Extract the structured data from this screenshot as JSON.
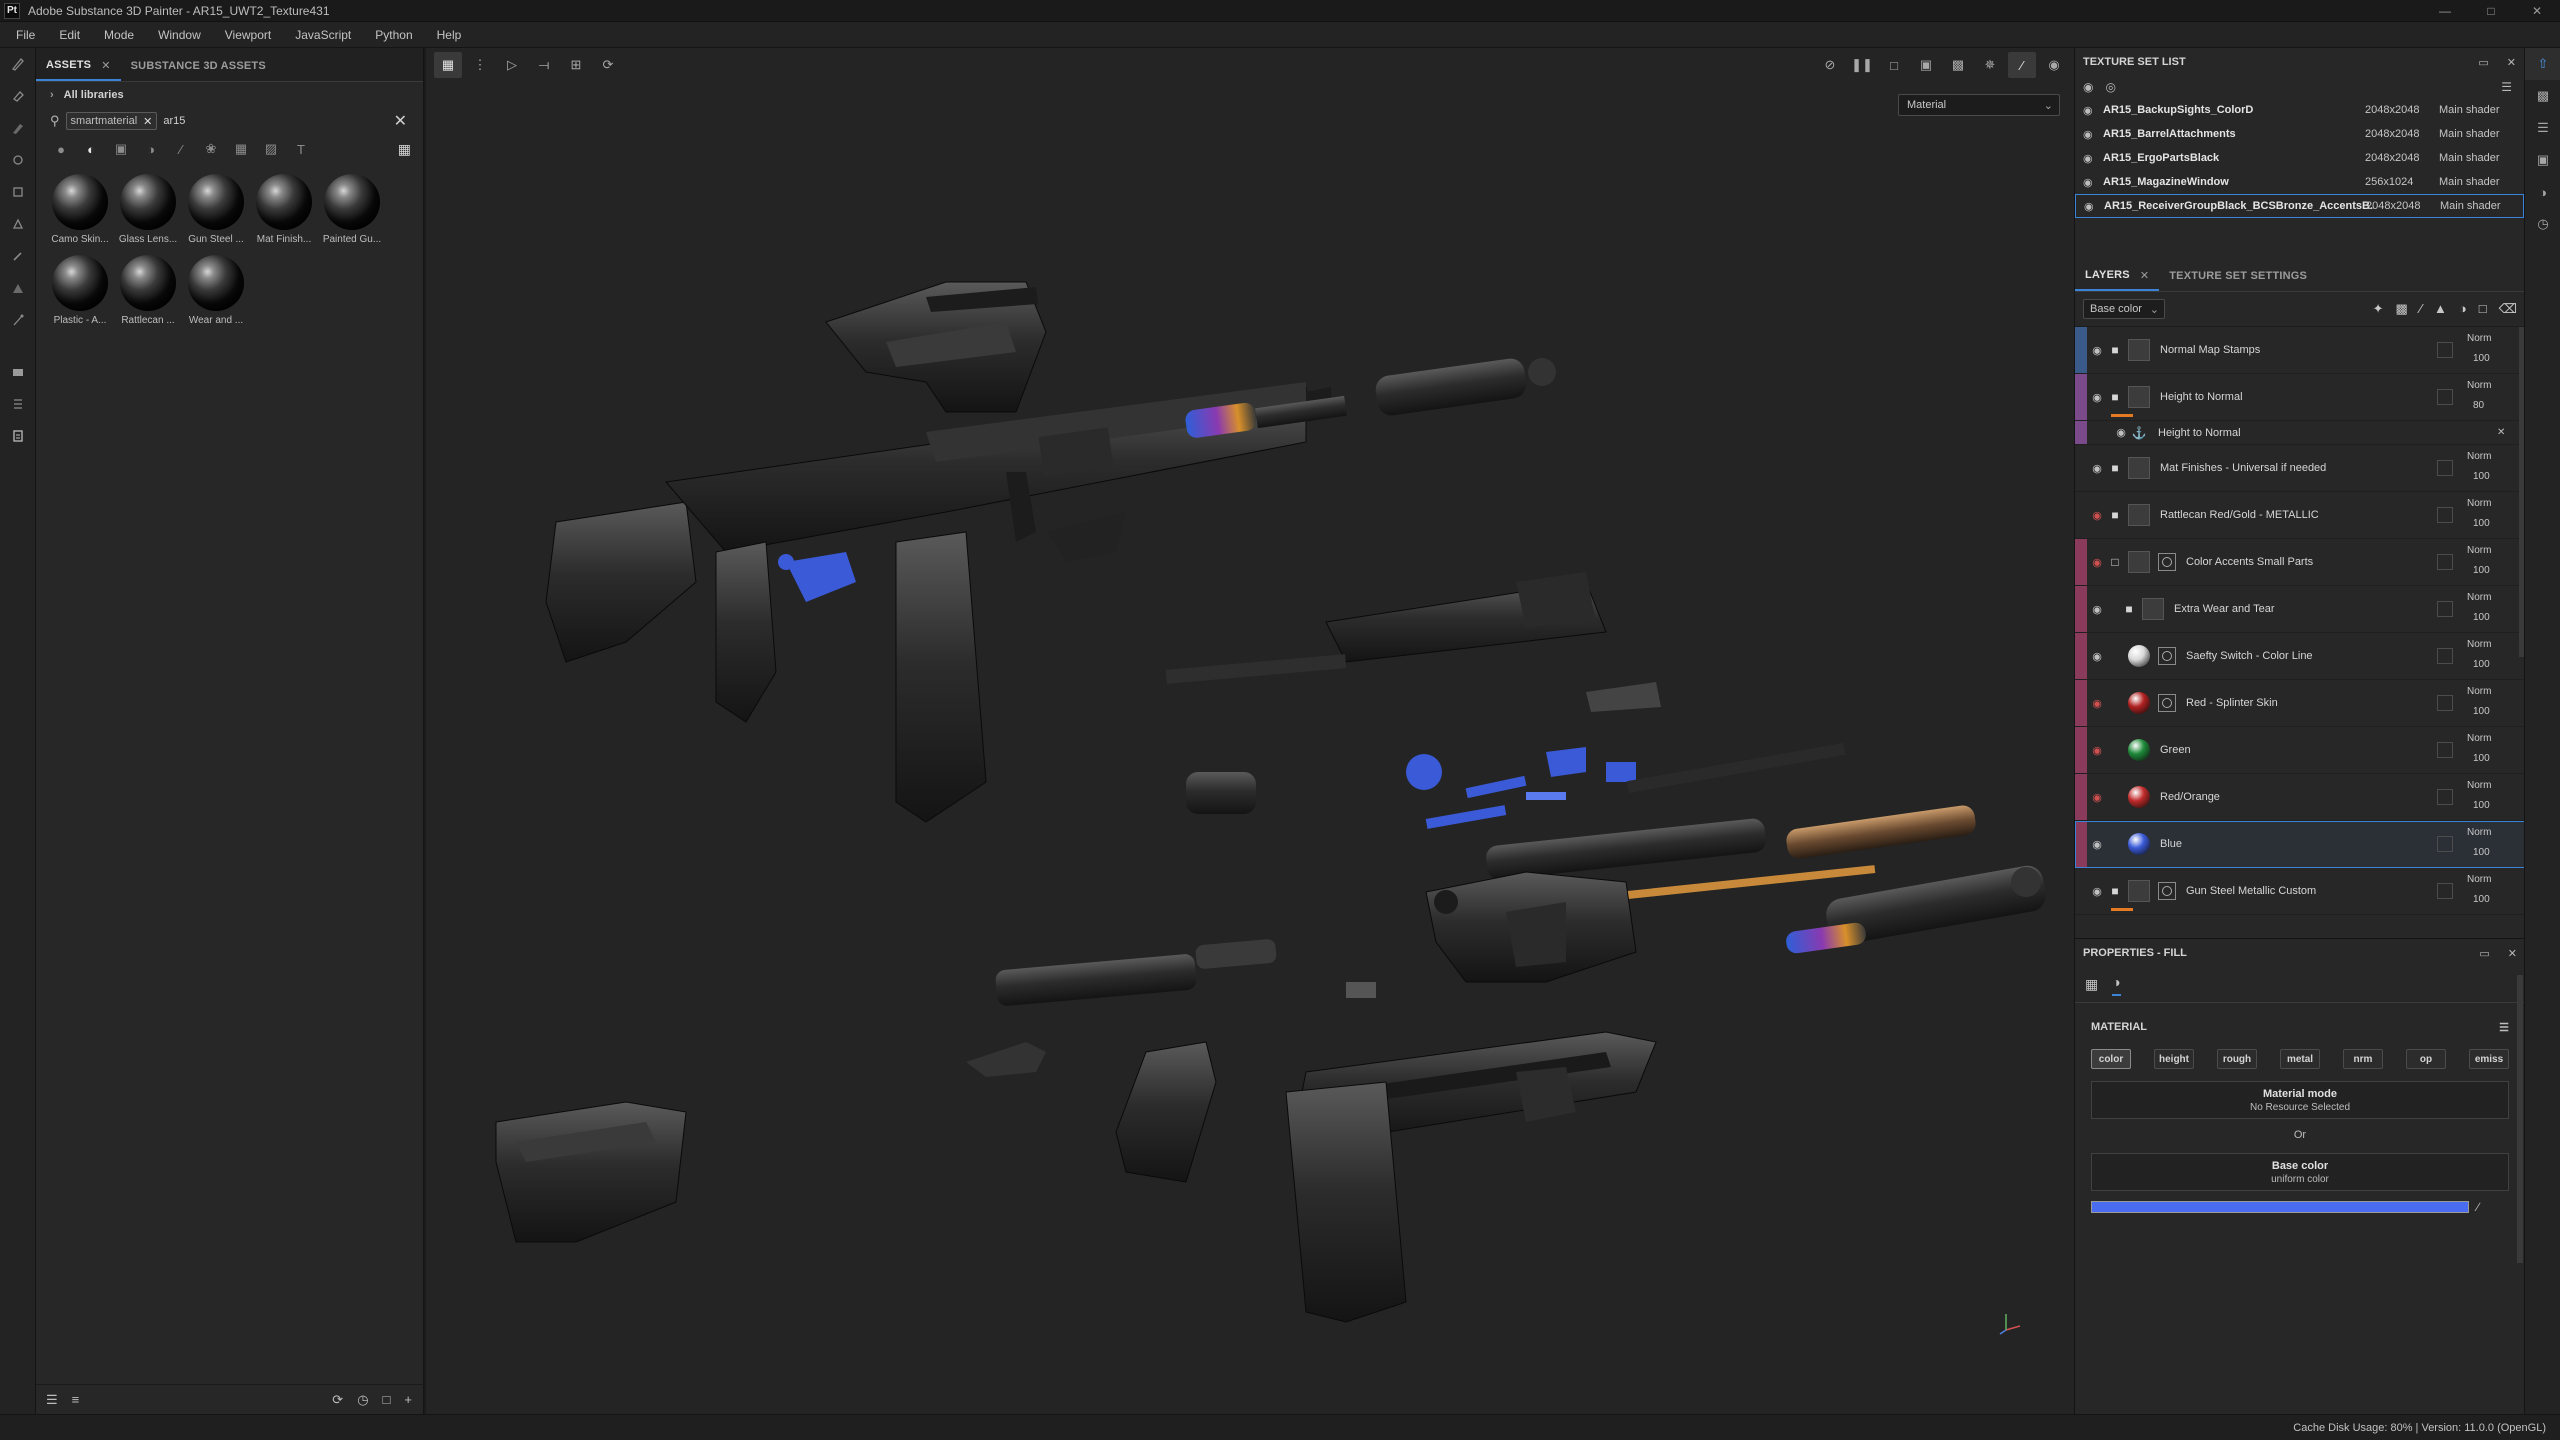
{
  "window": {
    "app_icon": "Pt",
    "title": "Adobe Substance 3D Painter - AR15_UWT2_Texture431",
    "controls": [
      "minimize-icon",
      "maximize-icon",
      "close-icon"
    ]
  },
  "menubar": [
    "File",
    "Edit",
    "Mode",
    "Window",
    "Viewport",
    "JavaScript",
    "Python",
    "Help"
  ],
  "tool_strip": [
    "paint-brush-icon",
    "eraser-icon",
    "projection-icon",
    "geometry-fill-icon",
    "smudge-icon",
    "clone-icon",
    "picker-icon",
    "polygon-fill-icon",
    "measure-icon",
    "bake-icon",
    "stack-icon",
    "shelf-icon"
  ],
  "assets_panel": {
    "tabs": [
      {
        "label": "ASSETS",
        "active": true,
        "closable": true
      },
      {
        "label": "SUBSTANCE 3D ASSETS",
        "active": false
      }
    ],
    "library_label": "All libraries",
    "search": {
      "chip": "smartmaterial",
      "value": "ar15"
    },
    "filters": [
      "all-icon",
      "material-icon",
      "smart-material-icon",
      "texture-icon",
      "brush-icon",
      "alpha-icon",
      "grunge-icon",
      "environment-icon",
      "text-icon"
    ],
    "assets": [
      {
        "label": "Camo Skin..."
      },
      {
        "label": "Glass Lens..."
      },
      {
        "label": "Gun Steel ..."
      },
      {
        "label": "Mat Finish..."
      },
      {
        "label": "Painted Gu..."
      },
      {
        "label": "Plastic - A..."
      },
      {
        "label": "Rattlecan ..."
      },
      {
        "label": "Wear and ..."
      }
    ]
  },
  "viewport": {
    "display_mode": "Material",
    "left_tools": [
      "grid-icon",
      "selection-icon",
      "symmetry-icon",
      "align-icon",
      "frame-icon",
      "history-icon"
    ],
    "right_tools": [
      "hide-icon",
      "pause-icon",
      "2d-3d-icon",
      "cube-icon",
      "camera-icon",
      "lights-icon",
      "paint-icon",
      "screenshot-icon"
    ]
  },
  "texture_set_list": {
    "title": "TEXTURE SET LIST",
    "items": [
      {
        "name": "AR15_BackupSights_ColorD",
        "resolution": "2048x2048",
        "shader": "Main shader",
        "selected": false
      },
      {
        "name": "AR15_BarrelAttachments",
        "resolution": "2048x2048",
        "shader": "Main shader",
        "selected": false
      },
      {
        "name": "AR15_ErgoPartsBlack",
        "resolution": "2048x2048",
        "shader": "Main shader",
        "selected": false
      },
      {
        "name": "AR15_MagazineWindow",
        "resolution": "256x1024",
        "shader": "Main shader",
        "selected": false
      },
      {
        "name": "AR15_ReceiverGroupBlack_BCSBronze_AccentsB...",
        "resolution": "2048x2048",
        "shader": "Main shader",
        "selected": true
      }
    ]
  },
  "layers_panel": {
    "tabs": [
      {
        "label": "LAYERS",
        "active": true,
        "closable": true
      },
      {
        "label": "TEXTURE SET SETTINGS",
        "active": false
      }
    ],
    "channel": "Base color",
    "layers": [
      {
        "name": "Normal Map Stamps",
        "type": "folder",
        "blend": "Norm",
        "opacity": "100",
        "stripe": "#3a5a8a",
        "eye": "normal",
        "thumb": "gray",
        "mask": false
      },
      {
        "name": "Height to Normal",
        "type": "folder",
        "blend": "Norm",
        "opacity": "80",
        "stripe": "#7a4a8a",
        "eye": "normal",
        "thumb": "gray",
        "mask": false,
        "orange": true
      },
      {
        "name": "Height to Normal",
        "type": "sub",
        "stripe": "#7a4a8a"
      },
      {
        "name": "Mat Finishes - Universal if needed",
        "type": "folder",
        "blend": "Norm",
        "opacity": "100",
        "stripe": "#272727",
        "eye": "normal",
        "thumb": "gray",
        "mask": false
      },
      {
        "name": "Rattlecan Red/Gold - METALLIC",
        "type": "folder",
        "blend": "Norm",
        "opacity": "100",
        "stripe": "#272727",
        "eye": "red",
        "thumb": "gray",
        "mask": false
      },
      {
        "name": "Color Accents Small Parts",
        "type": "folder-open",
        "blend": "Norm",
        "opacity": "100",
        "stripe": "#8a3a5a",
        "eye": "red",
        "thumb": "gray",
        "mask": true
      },
      {
        "name": "Extra Wear and Tear",
        "type": "folder-indent",
        "blend": "Norm",
        "opacity": "100",
        "stripe": "#8a3a5a",
        "eye": "normal",
        "thumb": "gray",
        "mask": false
      },
      {
        "name": "Saefty Switch - Color Line",
        "type": "fill",
        "blend": "Norm",
        "opacity": "100",
        "stripe": "#8a3a5a",
        "eye": "normal",
        "thumb": "#d8d8d8",
        "mask": true
      },
      {
        "name": "Red - Splinter Skin",
        "type": "fill",
        "blend": "Norm",
        "opacity": "100",
        "stripe": "#8a3a5a",
        "eye": "red",
        "thumb": "#b02020",
        "mask": true
      },
      {
        "name": "Green",
        "type": "fill",
        "blend": "Norm",
        "opacity": "100",
        "stripe": "#8a3a5a",
        "eye": "red",
        "thumb": "#1f8a3a",
        "mask": false
      },
      {
        "name": "Red/Orange",
        "type": "fill",
        "blend": "Norm",
        "opacity": "100",
        "stripe": "#8a3a5a",
        "eye": "red",
        "thumb": "#c02a2a",
        "mask": false
      },
      {
        "name": "Blue",
        "type": "fill",
        "blend": "Norm",
        "opacity": "100",
        "stripe": "#8a3a5a",
        "eye": "normal",
        "thumb": "#3a5ad8",
        "mask": false,
        "selected": true
      },
      {
        "name": "Gun Steel Metallic Custom",
        "type": "folder",
        "blend": "Norm",
        "opacity": "100",
        "stripe": "#272727",
        "eye": "normal",
        "thumb": "gray",
        "mask": true,
        "orange": true
      }
    ]
  },
  "properties": {
    "title": "PROPERTIES - FILL",
    "section": "MATERIAL",
    "channels": [
      {
        "label": "color",
        "on": true
      },
      {
        "label": "height",
        "on": false
      },
      {
        "label": "rough",
        "on": false
      },
      {
        "label": "metal",
        "on": false
      },
      {
        "label": "nrm",
        "on": false
      },
      {
        "label": "op",
        "on": false
      },
      {
        "label": "emiss",
        "on": false
      }
    ],
    "material_mode": {
      "title": "Material mode",
      "sub": "No Resource Selected"
    },
    "or_label": "Or",
    "base_color": {
      "title": "Base color",
      "sub": "uniform color",
      "value": "#4a6cf0"
    }
  },
  "statusbar": {
    "text": "Cache Disk Usage:    80% | Version: 11.0.0 (OpenGL)"
  },
  "colors": {
    "accent": "#3b83d6",
    "selected_color": "#4a6cf0"
  }
}
